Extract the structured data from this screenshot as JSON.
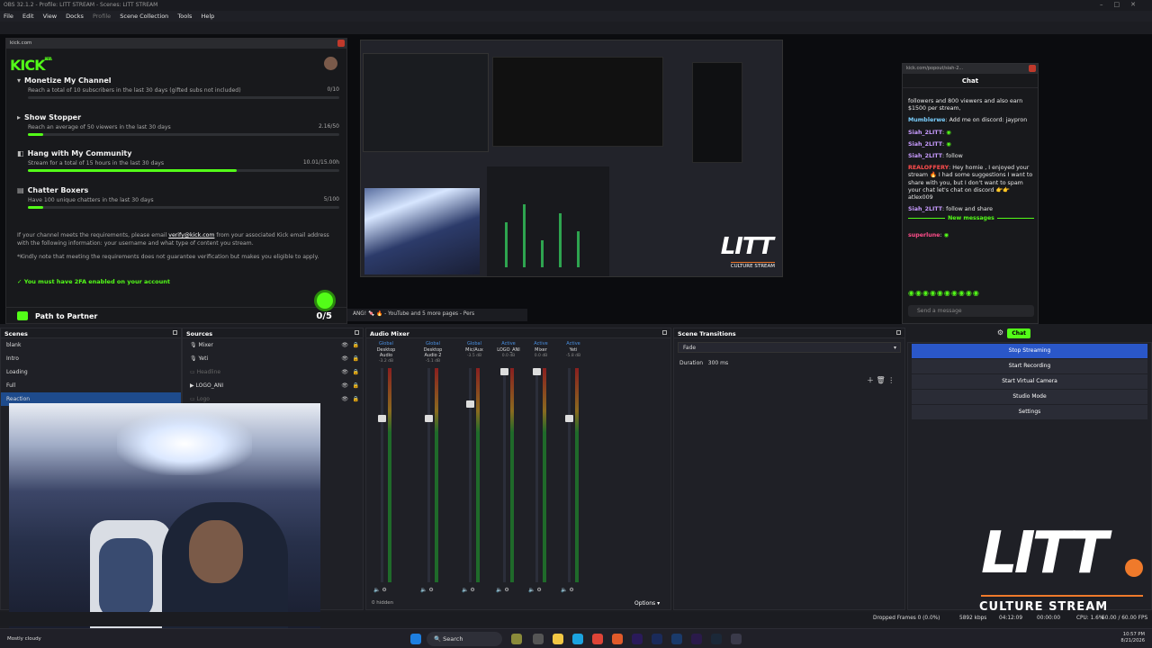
{
  "window": {
    "title": "OBS 32.1.2 - Profile: LITT STREAM - Scenes: LITT STREAM"
  },
  "menu": [
    "File",
    "Edit",
    "View",
    "Docks",
    "Profile",
    "Scene Collection",
    "Tools",
    "Help"
  ],
  "kick_panel": {
    "url": "kick.com",
    "logo": "KICK",
    "logo_tag": "BETA",
    "requirements": [
      {
        "title": "Monetize My Channel",
        "desc": "Reach a total of 10 subscribers in the last 30 days (gifted subs not included)",
        "value": "0/10",
        "progress": 0.0
      },
      {
        "title": "Show Stopper",
        "desc": "Reach an average of 50 viewers in the last 30 days",
        "value": "2.16/50",
        "progress": 0.05
      },
      {
        "title": "Hang with My Community",
        "desc": "Stream for a total of 15 hours in the last 30 days",
        "value": "10.01/15.00h",
        "progress": 0.67
      },
      {
        "title": "Chatter Boxers",
        "desc": "Have 100 unique chatters in the last 30 days",
        "value": "5/100",
        "progress": 0.05
      }
    ],
    "note1_pre": "If your channel meets the requirements, please email ",
    "note1_link": "verify@kick.com",
    "note1_post": " from your associated Kick email address with the following information: your username and what type of content you stream.",
    "note2": "*Kindly note that meeting the requirements does not guarantee verification but makes you eligible to apply.",
    "twofa": "You must have 2FA enabled on your account",
    "footer_label": "Path to Partner",
    "footer_count": "0/5"
  },
  "tab_strip": "ANG! 🍬 🔥 - YouTube and 5 more pages - Pers",
  "chat": {
    "url": "kick.com/popout/siah-2...",
    "title": "Chat",
    "messages": [
      {
        "user": "",
        "text": "followers and 800 viewers and also earn $1500 per stream,"
      },
      {
        "user": "Mumblerwe",
        "text": ": Add me on discord: jaypron"
      },
      {
        "user": "Siah_2LITT",
        "text": ":"
      },
      {
        "user": "Siah_2LITT",
        "text": ":"
      },
      {
        "user": "Siah_2LITT",
        "text": ": follow"
      },
      {
        "user": "REALOFFERY",
        "text": ": Hey homie , I enjoyed your stream 🔥 I had some suggestions I want to share with you, but I don't want to spam your chat let's chat on discord 👉👉 atlex009"
      },
      {
        "user": "Siah_2LITT",
        "text": ": follow and share"
      }
    ],
    "new_messages": "New messages",
    "last_user": "superlune",
    "input_placeholder": "Send a message",
    "send_label": "Chat"
  },
  "docks": {
    "scenes": {
      "title": "Scenes",
      "items": [
        "blank",
        "Intro",
        "Loading",
        "Full",
        "Reaction"
      ],
      "selected": "Reaction"
    },
    "sources": {
      "title": "Sources",
      "items": [
        "Mixer",
        "Yeti",
        "Headline",
        "LOGO_ANI",
        "Logo"
      ]
    },
    "mixer": {
      "title": "Audio Mixer",
      "channels": [
        {
          "tag": "Global",
          "name": "Desktop Audio",
          "db": "-3.2 dB",
          "knob": 0.22
        },
        {
          "tag": "Global",
          "name": "Desktop Audio 2",
          "db": "-5.1 dB",
          "knob": 0.22
        },
        {
          "tag": "Global",
          "name": "Mic/Aux",
          "db": "-3.5 dB",
          "knob": 0.15
        },
        {
          "tag": "Active",
          "name": "LOGO_ANI",
          "db": "0.0 dB",
          "knob": 0.0
        },
        {
          "tag": "Active",
          "name": "Mixer",
          "db": "0.0 dB",
          "knob": 0.0
        },
        {
          "tag": "Active",
          "name": "Yeti",
          "db": "-5.8 dB",
          "knob": 0.22
        }
      ],
      "hidden": "0 hidden",
      "options": "Options"
    },
    "transitions": {
      "title": "Scene Transitions",
      "type": "Fade",
      "duration_label": "Duration",
      "duration": "300 ms"
    },
    "controls": [
      "Stop Streaming",
      "Start Recording",
      "Start Virtual Camera",
      "Studio Mode",
      "Settings"
    ]
  },
  "overlay": {
    "brand": "LITT",
    "tagline": "CULTURE STREAM"
  },
  "status_bar": {
    "dropped": "Dropped Frames 0 (0.0%)",
    "bitrate": "5892 kbps",
    "stream_time": "04:12:09",
    "rec_time": "00:00:00",
    "cpu": "CPU: 1.6%",
    "fps": "60.00 / 60.00 FPS"
  },
  "taskbar": {
    "weather": "Mostly cloudy",
    "search": "Search",
    "time": "10:57 PM",
    "date": "8/21/2026"
  },
  "colors": {
    "kick_green": "#53fc18",
    "accent_blue": "#2a57c8",
    "litt_orange": "#ef7a2b"
  }
}
